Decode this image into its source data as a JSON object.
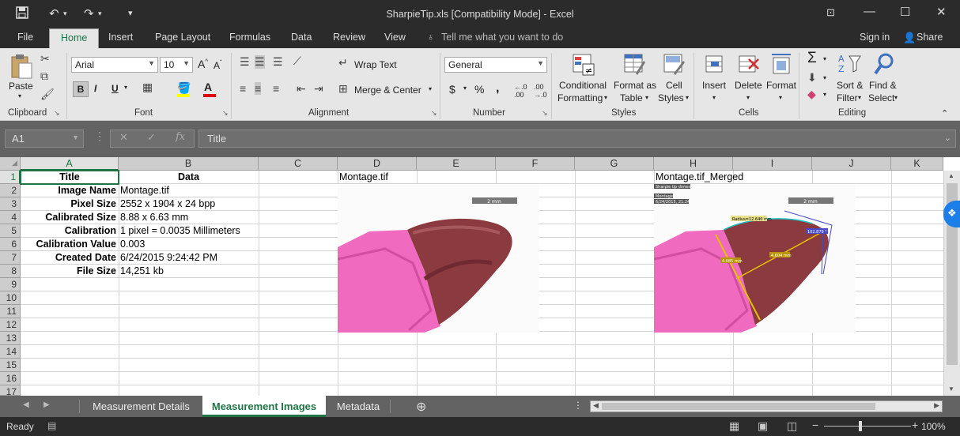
{
  "window": {
    "title": "SharpieTip.xls  [Compatibility Mode] - Excel"
  },
  "menu": {
    "tabs": [
      "File",
      "Home",
      "Insert",
      "Page Layout",
      "Formulas",
      "Data",
      "Review",
      "View"
    ],
    "tell_me": "Tell me what you want to do",
    "sign_in": "Sign in",
    "share": "Share"
  },
  "ribbon": {
    "clipboard": {
      "paste": "Paste",
      "label": "Clipboard"
    },
    "font": {
      "name": "Arial",
      "size": "10",
      "label": "Font"
    },
    "alignment": {
      "wrap": "Wrap Text",
      "merge": "Merge & Center",
      "label": "Alignment"
    },
    "number": {
      "format": "General",
      "currency": "$",
      "percent": "%",
      "comma": ",",
      "label": "Number"
    },
    "styles": {
      "conditional": "Conditional",
      "formatting": "Formatting",
      "format_as": "Format as",
      "table": "Table",
      "cell": "Cell",
      "styles_label": "Styles",
      "label": "Styles"
    },
    "cells": {
      "insert": "Insert",
      "delete": "Delete",
      "format": "Format",
      "label": "Cells"
    },
    "editing": {
      "sort": "Sort &",
      "filter": "Filter",
      "find": "Find &",
      "select": "Select",
      "label": "Editing"
    }
  },
  "formula_bar": {
    "name_box": "A1",
    "content": "Title"
  },
  "grid": {
    "columns": [
      "A",
      "B",
      "C",
      "D",
      "E",
      "F",
      "G",
      "H",
      "I",
      "J",
      "K"
    ],
    "rows": [
      "1",
      "2",
      "3",
      "4",
      "5",
      "6",
      "7",
      "8",
      "9",
      "10",
      "11",
      "12",
      "13",
      "14",
      "15",
      "16",
      "17"
    ],
    "header_title": "Title",
    "header_data": "Data",
    "records": [
      {
        "label": "Image Name",
        "value": "Montage.tif"
      },
      {
        "label": "Pixel Size",
        "value": "2552 x 1904 x 24 bpp"
      },
      {
        "label": "Calibrated Size",
        "value": "8.88 x 6.63 mm"
      },
      {
        "label": "Calibration",
        "value": "1 pixel = 0.0035 Millimeters"
      },
      {
        "label": "Calibration Value",
        "value": "0.003"
      },
      {
        "label": "Created Date",
        "value": "6/24/2015 9:24:42 PM"
      },
      {
        "label": "File Size",
        "value": "14,251 kb"
      }
    ],
    "d1": "Montage.tif",
    "h1": "Montage.tif_Merged"
  },
  "images": {
    "left": {
      "scale": "2 mm"
    },
    "right": {
      "scale": "2 mm",
      "caption1": "Sharpie tip dimensions",
      "caption2": "Montage.tif",
      "caption3": "6/24/2015, 21:24",
      "radius": "Radius=12.640 mm",
      "angle": "102.879 °",
      "len1": "4.085 mm",
      "len2": "4.604 mm"
    }
  },
  "sheets": {
    "tabs": [
      "Measurement Details",
      "Measurement Images",
      "Metadata"
    ],
    "active": "Measurement Images"
  },
  "status": {
    "ready": "Ready",
    "zoom": "100%"
  },
  "colors": {
    "accent": "#217346",
    "pink": "#f06ac0",
    "tip": "#8b3a3f"
  }
}
